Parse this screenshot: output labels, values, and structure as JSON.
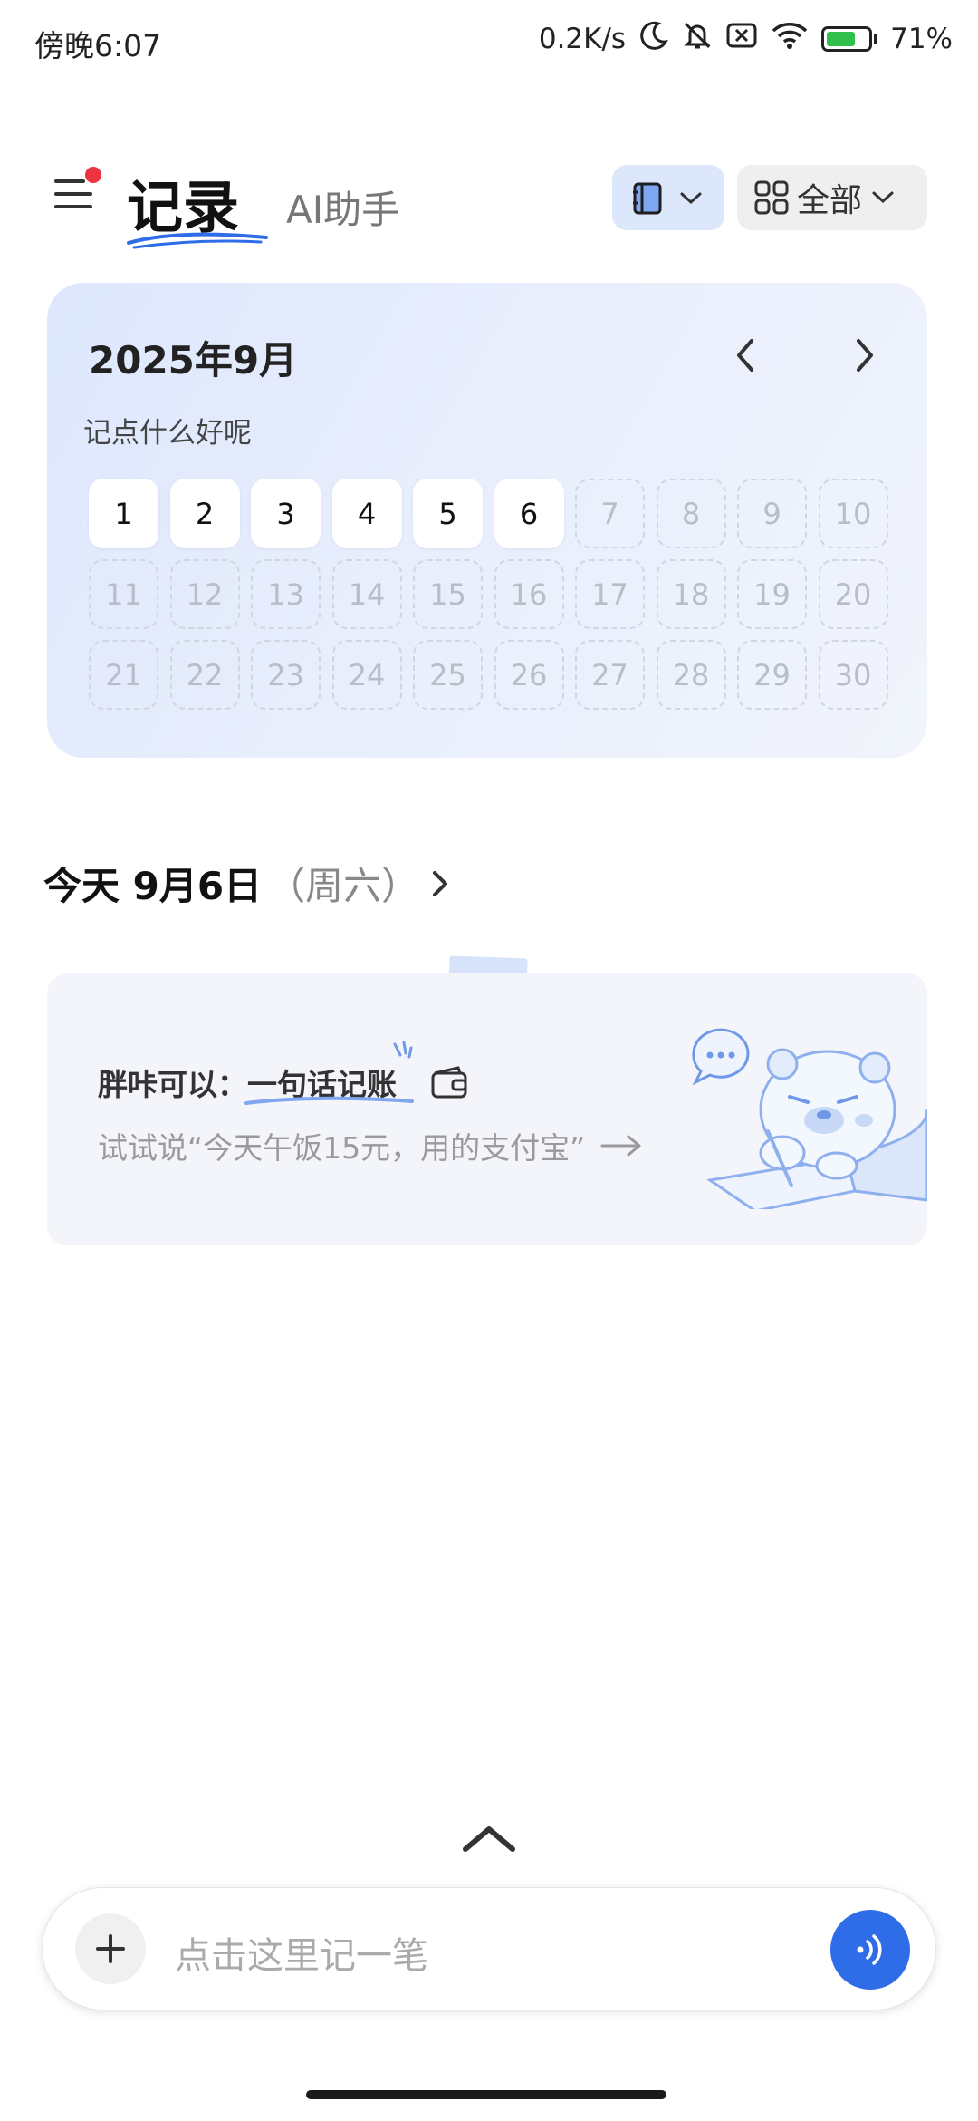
{
  "status_bar": {
    "time": "傍晚6:07",
    "net_speed": "0.2K/s",
    "battery": "71%",
    "battery_level": 0.71,
    "icons": [
      "moon-icon",
      "bell-off-icon",
      "sim-off-icon",
      "wifi-icon",
      "battery-charging-icon"
    ]
  },
  "header": {
    "tab_active": "记录",
    "tab_other": "AI助手",
    "filter_label": "全部",
    "has_notification_dot": true
  },
  "calendar": {
    "title": "2025年9月",
    "subtitle": "记点什么好呢",
    "days": [
      "1",
      "2",
      "3",
      "4",
      "5",
      "6",
      "7",
      "8",
      "9",
      "10",
      "11",
      "12",
      "13",
      "14",
      "15",
      "16",
      "17",
      "18",
      "19",
      "20",
      "21",
      "22",
      "23",
      "24",
      "25",
      "26",
      "27",
      "28",
      "29",
      "30"
    ],
    "last_active_day": 6
  },
  "today": {
    "date": "今天 9月6日",
    "weekday": "（周六）"
  },
  "tip": {
    "prefix": "胖咔可以：",
    "highlight": "一句话记账",
    "example": "试试说“今天午饭15元，用的支付宝”",
    "arrow": "→"
  },
  "input": {
    "placeholder": "点击这里记一笔"
  },
  "colors": {
    "accent": "#2f6de8",
    "calendar_bg": "#dde7fd",
    "notification": "#ee3340"
  }
}
